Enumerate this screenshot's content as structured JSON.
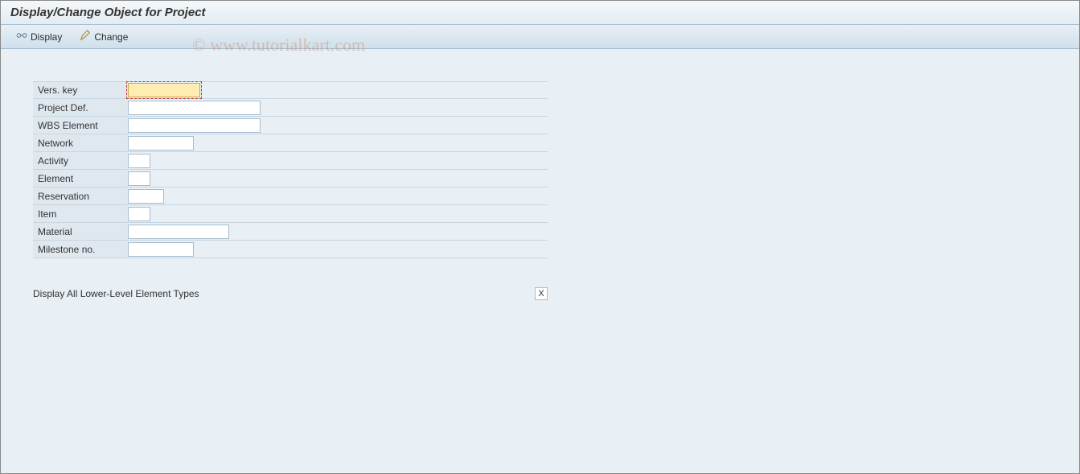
{
  "header": {
    "title": "Display/Change Object for Project"
  },
  "toolbar": {
    "display_label": "Display",
    "change_label": "Change"
  },
  "fields": {
    "vers_key": {
      "label": "Vers. key",
      "value": ""
    },
    "project_def": {
      "label": "Project Def.",
      "value": ""
    },
    "wbs_element": {
      "label": "WBS Element",
      "value": ""
    },
    "network": {
      "label": "Network",
      "value": ""
    },
    "activity": {
      "label": "Activity",
      "value": ""
    },
    "element": {
      "label": "Element",
      "value": ""
    },
    "reservation": {
      "label": "Reservation",
      "value": ""
    },
    "item": {
      "label": "Item",
      "value": ""
    },
    "material": {
      "label": "Material",
      "value": ""
    },
    "milestone_no": {
      "label": "Milestone no.",
      "value": ""
    }
  },
  "lower_option": {
    "label": "Display All Lower-Level Element Types",
    "value": "X"
  },
  "watermark": "© www.tutorialkart.com"
}
